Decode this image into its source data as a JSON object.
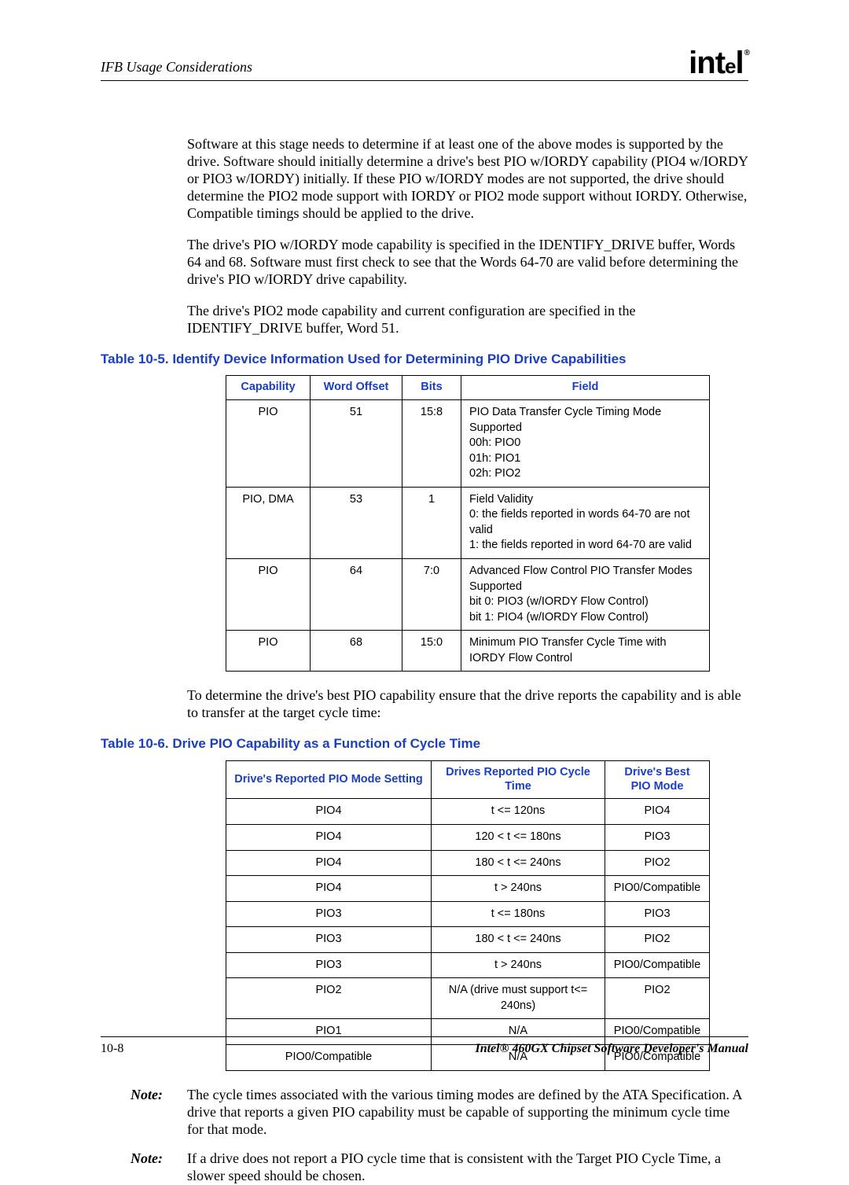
{
  "header": {
    "section_title": "IFB Usage Considerations",
    "logo_prefix": "int",
    "logo_e": "e",
    "logo_suffix": "l",
    "logo_reg": "®"
  },
  "paragraphs": {
    "p1": "Software at this stage needs to determine if at least one of the above modes is supported by the drive. Software should initially determine a drive's best PIO w/IORDY capability (PIO4 w/IORDY or PIO3 w/IORDY) initially. If these PIO w/IORDY modes are not supported, the drive should determine the PIO2 mode support with IORDY or PIO2 mode support without IORDY. Otherwise, Compatible timings should be applied to the drive.",
    "p2": "The drive's PIO w/IORDY mode capability is specified in the IDENTIFY_DRIVE buffer, Words 64 and 68. Software must first check to see that the Words 64-70 are valid before determining the drive's PIO w/IORDY drive capability.",
    "p3": "The drive's PIO2 mode capability and current configuration are specified in the IDENTIFY_DRIVE buffer, Word 51.",
    "p4": "To determine the drive's best PIO capability ensure that the drive reports the capability and is able to transfer at the target cycle time:"
  },
  "table1": {
    "caption": "Table 10-5. Identify Device Information Used for Determining PIO Drive Capabilities",
    "headers": {
      "c1": "Capability",
      "c2": "Word Offset",
      "c3": "Bits",
      "c4": "Field"
    },
    "rows": [
      {
        "c1": "PIO",
        "c2": "51",
        "c3": "15:8",
        "c4": "PIO Data Transfer Cycle Timing Mode Supported\n00h: PIO0\n01h: PIO1\n02h: PIO2"
      },
      {
        "c1": "PIO, DMA",
        "c2": "53",
        "c3": "1",
        "c4": "Field Validity\n0: the fields reported in words 64-70 are not valid\n1: the fields reported in word 64-70 are valid"
      },
      {
        "c1": "PIO",
        "c2": "64",
        "c3": "7:0",
        "c4": "Advanced Flow Control PIO Transfer Modes Supported\nbit 0: PIO3 (w/IORDY Flow Control)\nbit 1: PIO4 (w/IORDY Flow Control)"
      },
      {
        "c1": "PIO",
        "c2": "68",
        "c3": "15:0",
        "c4": "Minimum PIO Transfer Cycle Time with IORDY Flow Control"
      }
    ]
  },
  "table2": {
    "caption": "Table 10-6. Drive PIO Capability as a Function of Cycle Time",
    "headers": {
      "c1": "Drive's Reported PIO Mode Setting",
      "c2": "Drives Reported PIO Cycle Time",
      "c3": "Drive's Best PIO Mode"
    },
    "rows": [
      {
        "c1": "PIO4",
        "c2": "t <= 120ns",
        "c3": "PIO4"
      },
      {
        "c1": "PIO4",
        "c2": "120 < t <= 180ns",
        "c3": "PIO3"
      },
      {
        "c1": "PIO4",
        "c2": "180 < t <= 240ns",
        "c3": "PIO2"
      },
      {
        "c1": "PIO4",
        "c2": "t > 240ns",
        "c3": "PIO0/Compatible"
      },
      {
        "c1": "PIO3",
        "c2": "t <= 180ns",
        "c3": "PIO3"
      },
      {
        "c1": "PIO3",
        "c2": "180 < t <= 240ns",
        "c3": "PIO2"
      },
      {
        "c1": "PIO3",
        "c2": "t > 240ns",
        "c3": "PIO0/Compatible"
      },
      {
        "c1": "PIO2",
        "c2": "N/A (drive must support t<= 240ns)",
        "c3": "PIO2"
      },
      {
        "c1": "PIO1",
        "c2": "N/A",
        "c3": "PIO0/Compatible"
      },
      {
        "c1": "PIO0/Compatible",
        "c2": "N/A",
        "c3": "PIO0/Compatible"
      }
    ]
  },
  "notes": {
    "label": "Note:",
    "n1": "The cycle times associated with the various timing modes are defined by the ATA Specification. A drive that reports a given PIO capability must be capable of supporting the minimum cycle time for that mode.",
    "n2": "If a drive does not report a PIO cycle time that is consistent with the Target PIO Cycle Time, a slower speed should be chosen."
  },
  "footer": {
    "page": "10-8",
    "manual": "Intel® 460GX Chipset Software Developer's Manual"
  }
}
